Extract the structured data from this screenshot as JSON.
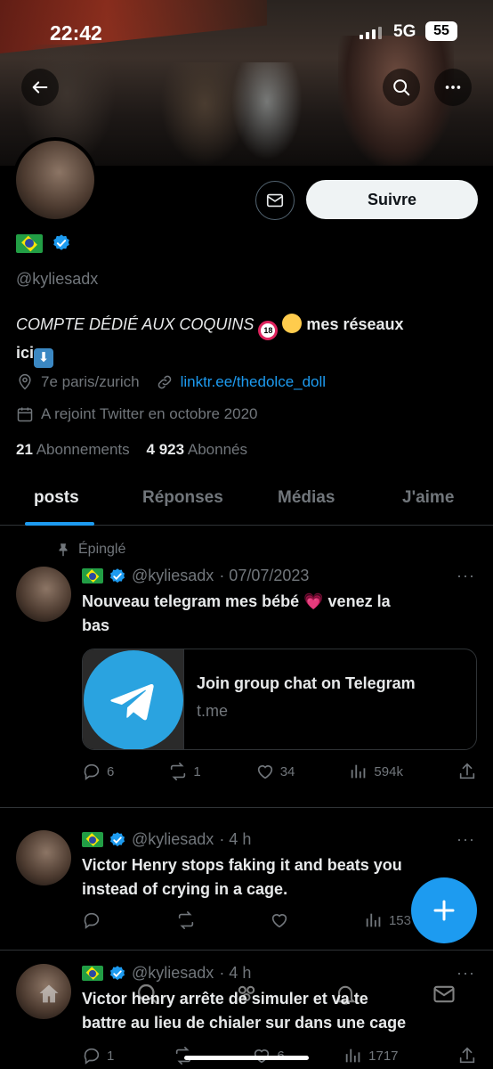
{
  "status_bar": {
    "time": "22:42",
    "network": "5G",
    "battery": "55"
  },
  "profile": {
    "handle": "@kyliesadx",
    "follow_button": "Suivre",
    "bio_italic": "COMPTE DÉDIÉ AUX COQUINS",
    "bio_rest": "mes réseaux",
    "bio_line2": "ici",
    "location": "7e  paris/zurich",
    "website": "linktr.ee/thedolce_doll",
    "joined": "A rejoint Twitter en octobre 2020",
    "following_count": "21",
    "following_label": "Abonnements",
    "followers_count": "4 923",
    "followers_label": "Abonnés"
  },
  "tabs": [
    {
      "label": "posts",
      "active": true
    },
    {
      "label": "Réponses"
    },
    {
      "label": "Médias"
    },
    {
      "label": "J'aime"
    }
  ],
  "posts": [
    {
      "pinned_label": "Épinglé",
      "handle": "@kyliesadx",
      "time": "· 07/07/2023",
      "text_line1": "Nouveau telegram mes bébé",
      "text_line1b": "venez la",
      "text_line2": "bas",
      "card_title": "Join group chat on Telegram",
      "card_domain": "t.me",
      "replies": "6",
      "retweets": "1",
      "likes": "34",
      "views": "594k"
    },
    {
      "handle": "@kyliesadx",
      "time": "· 4 h",
      "text_line1": "Victor Henry stops faking it and beats you",
      "text_line2": "instead of crying in a cage.",
      "views": "153"
    },
    {
      "handle": "@kyliesadx",
      "time": "· 4 h",
      "text_line1": "Victor henry arrête de simuler et va te",
      "text_line2": "battre au lieu de chialer sur dans une cage",
      "replies": "1",
      "likes": "6",
      "views": "1717"
    }
  ],
  "colors": {
    "accent": "#1d9bf0",
    "background": "#000000",
    "muted": "#71767b"
  }
}
